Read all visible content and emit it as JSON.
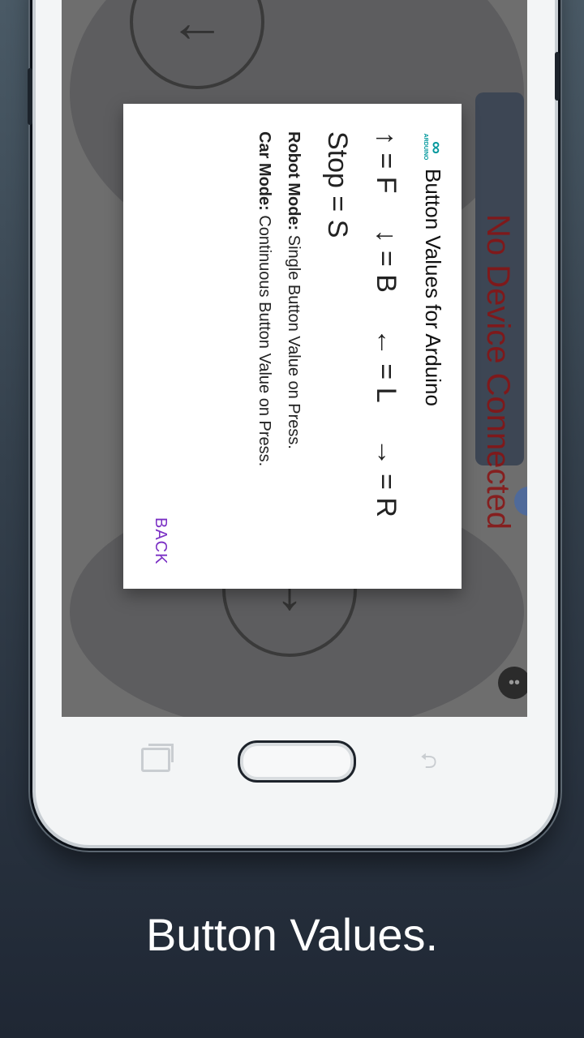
{
  "dialog": {
    "logo_symbol": "∞",
    "logo_text": "ARDUINO",
    "title": "Button Values for Arduino",
    "values": [
      {
        "arrow": "↑",
        "eq": "= F"
      },
      {
        "arrow": "↓",
        "eq": "= B"
      },
      {
        "arrow": "←",
        "eq": "= L"
      },
      {
        "arrow": "→",
        "eq": "= R"
      }
    ],
    "stop": "Stop = S",
    "robot_mode": {
      "label": "Robot Mode:",
      "text": "Single Button Value on Press."
    },
    "car_mode": {
      "label": "Car Mode:",
      "text": "Continuous Button Value on Press."
    },
    "back_label": "BACK"
  },
  "background": {
    "status_text": "No Device Connected",
    "up_arrow": "←",
    "down_arrow": "↓"
  },
  "caption": "Button Values.",
  "colors": {
    "arduino_teal": "#00979c",
    "back_purple": "#7a2fc4",
    "status_red": "#8a1212"
  }
}
